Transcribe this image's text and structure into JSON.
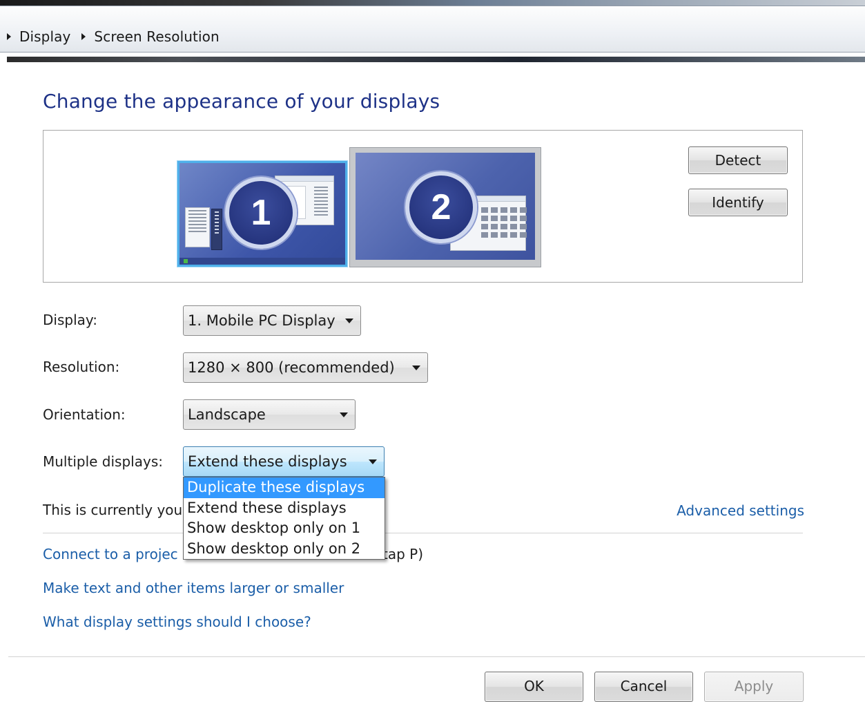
{
  "breadcrumb": {
    "items": [
      "Display",
      "Screen Resolution"
    ]
  },
  "page": {
    "title": "Change the appearance of your displays"
  },
  "preview": {
    "monitor_1_label": "1",
    "monitor_2_label": "2",
    "detect_label": "Detect",
    "identify_label": "Identify"
  },
  "settings": {
    "display_label": "Display:",
    "display_value": "1. Mobile PC Display",
    "resolution_label": "Resolution:",
    "resolution_value": "1280 × 800 (recommended)",
    "orientation_label": "Orientation:",
    "orientation_value": "Landscape",
    "multiple_label": "Multiple displays:",
    "multiple_value": "Extend these displays"
  },
  "dropdown": {
    "options": [
      "Duplicate these displays",
      "Extend these displays",
      "Show desktop only on 1",
      "Show desktop only on 2"
    ],
    "highlighted": "Duplicate these displays"
  },
  "info": {
    "current_text": "This is currently you",
    "advanced_link": "Advanced settings"
  },
  "links": {
    "connect": "Connect to a projec",
    "connect_suffix": "tap P)",
    "text_size": "Make text and other items larger or smaller",
    "help": "What display settings should I choose?"
  },
  "footer": {
    "ok": "OK",
    "cancel": "Cancel",
    "apply": "Apply"
  },
  "colors": {
    "heading": "#1e3287",
    "link": "#1b5ea8",
    "selection": "#3399ff",
    "monitor_active_border": "#4fb0ea"
  }
}
